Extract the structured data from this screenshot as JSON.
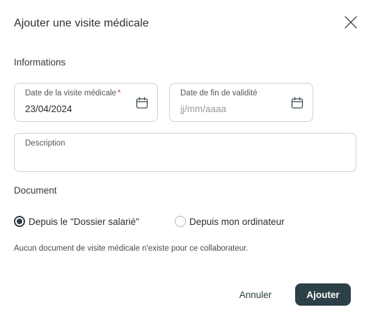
{
  "dialog": {
    "title": "Ajouter une visite médicale",
    "close_icon": "close-icon"
  },
  "informations": {
    "section_label": "Informations",
    "visit_date": {
      "label": "Date de la visite médicale",
      "required_mark": "*",
      "value": "23/04/2024",
      "icon": "calendar-icon"
    },
    "end_date": {
      "label": "Date de fin de validité",
      "value": "",
      "placeholder": "jj/mm/aaaa",
      "icon": "calendar-icon"
    },
    "description": {
      "label": "Description",
      "value": ""
    }
  },
  "document": {
    "section_label": "Document",
    "options": [
      {
        "label": "Depuis le \"Dossier salarié\"",
        "selected": true
      },
      {
        "label": "Depuis mon ordinateur",
        "selected": false
      }
    ],
    "info_text": "Aucun document de visite médicale n'existe pour ce collaborateur."
  },
  "actions": {
    "cancel_label": "Annuler",
    "submit_label": "Ajouter"
  },
  "colors": {
    "primary": "#2c4147",
    "required": "#c0392b",
    "border": "#cfcfcf"
  }
}
